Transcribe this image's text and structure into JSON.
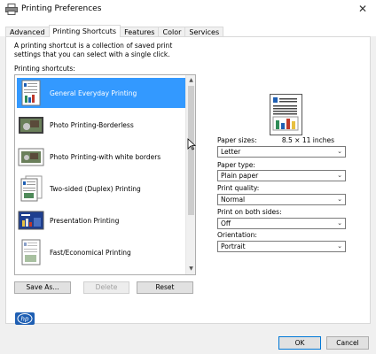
{
  "window": {
    "title": "Printing Preferences",
    "close_glyph": "✕"
  },
  "tabs": [
    {
      "label": "Advanced"
    },
    {
      "label": "Printing Shortcuts",
      "active": true
    },
    {
      "label": "Features"
    },
    {
      "label": "Color"
    },
    {
      "label": "Services"
    }
  ],
  "shortcuts": {
    "description": "A printing shortcut is a collection of saved print settings that you can select with a single click.",
    "list_label": "Printing shortcuts:",
    "items": [
      {
        "label": "General Everyday Printing",
        "icon": "document-chart-icon",
        "selected": true
      },
      {
        "label": "Photo Printing-Borderless",
        "icon": "photo-borderless-icon"
      },
      {
        "label": "Photo Printing-with white borders",
        "icon": "photo-bordered-icon"
      },
      {
        "label": "Two-sided (Duplex) Printing",
        "icon": "duplex-document-icon"
      },
      {
        "label": "Presentation Printing",
        "icon": "presentation-icon"
      },
      {
        "label": "Fast/Economical Printing",
        "icon": "economy-document-icon"
      }
    ],
    "buttons": {
      "save_as": "Save As...",
      "delete": "Delete",
      "reset": "Reset"
    }
  },
  "settings": {
    "paper_sizes_label": "Paper sizes:",
    "paper_sizes_dimension": "8.5 × 11 inches",
    "paper_size_value": "Letter",
    "paper_type_label": "Paper type:",
    "paper_type_value": "Plain paper",
    "print_quality_label": "Print quality:",
    "print_quality_value": "Normal",
    "print_both_sides_label": "Print on both sides:",
    "print_both_sides_value": "Off",
    "orientation_label": "Orientation:",
    "orientation_value": "Portrait"
  },
  "footer": {
    "ok": "OK",
    "cancel": "Cancel"
  },
  "colors": {
    "selection": "#3399ff",
    "accent": "#0078d7",
    "hp_blue": "#1f5fb3"
  }
}
